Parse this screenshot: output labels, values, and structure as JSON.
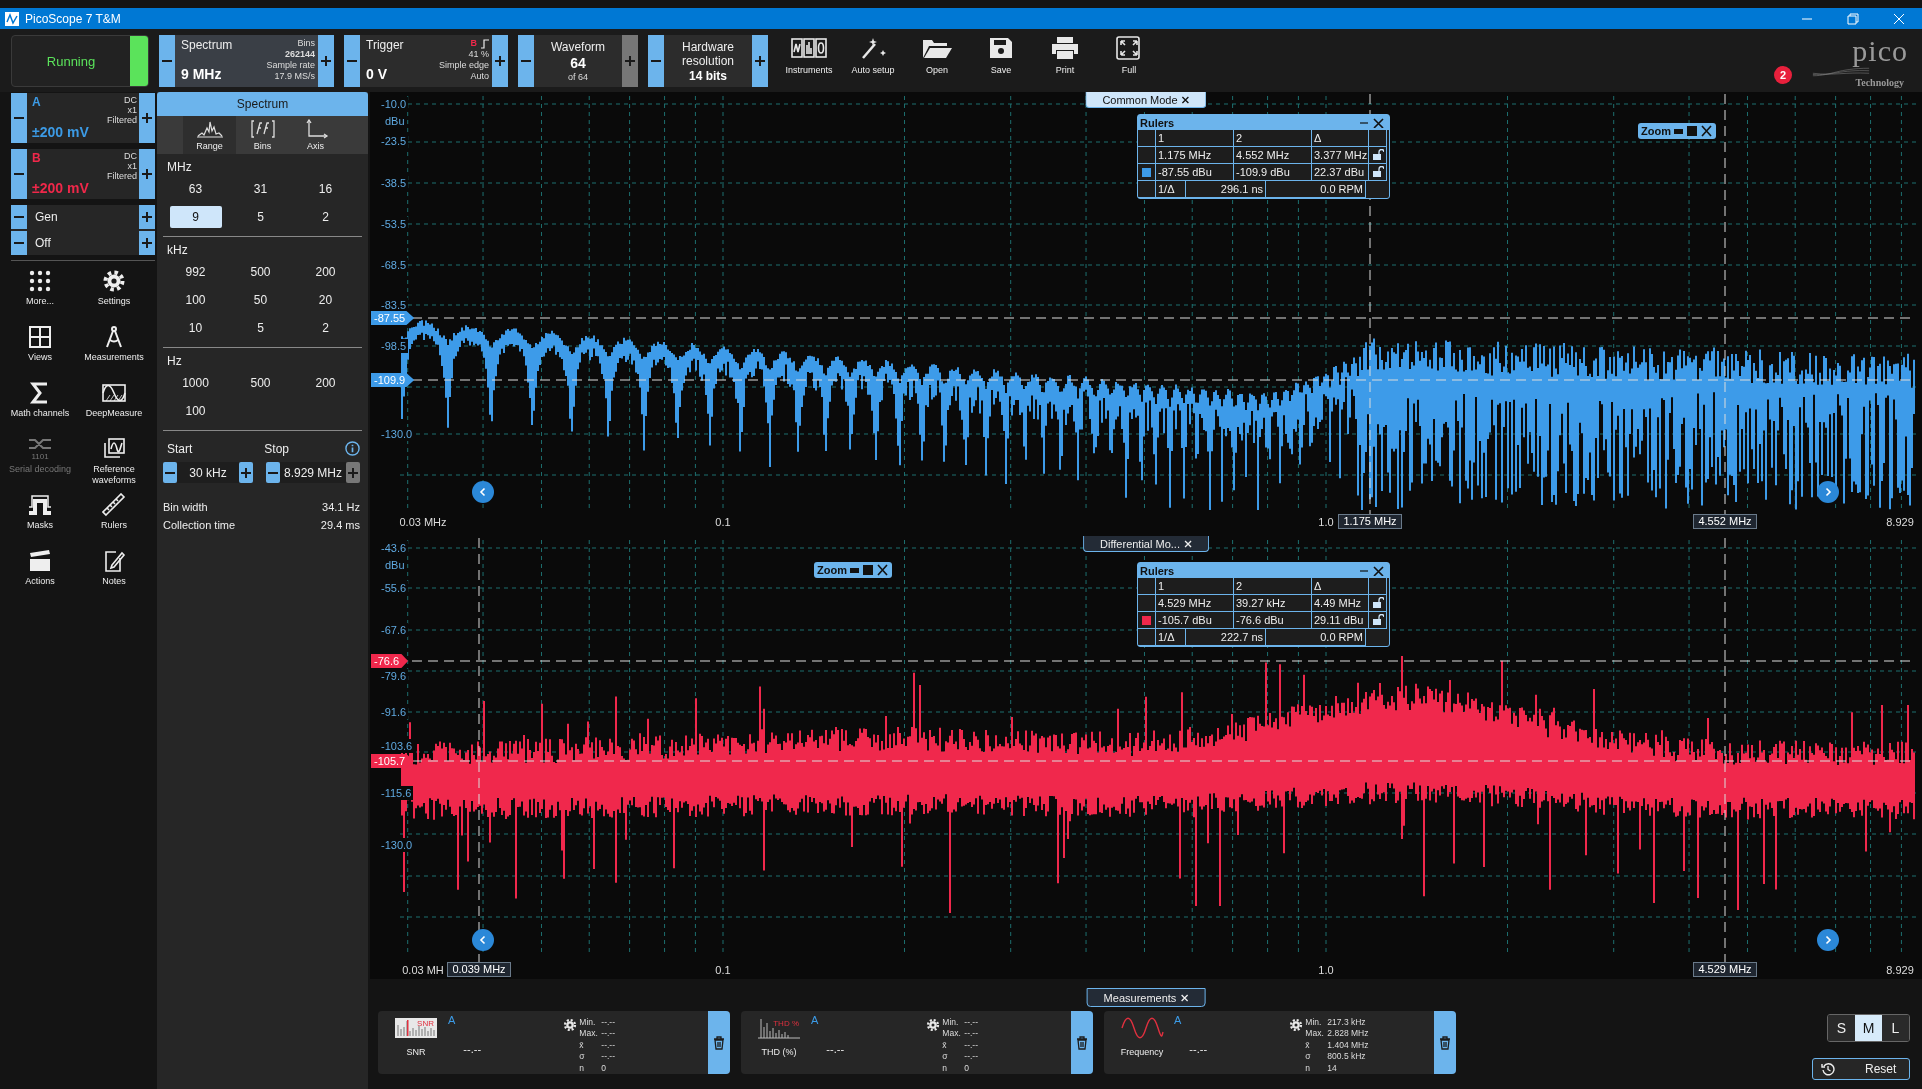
{
  "window": {
    "title": "PicoScope 7 T&M"
  },
  "run_button": {
    "label": "Running",
    "on": true
  },
  "spectrum": {
    "title": "Spectrum",
    "value": "9 MHz",
    "info": [
      "Bins",
      "262144",
      "Sample rate",
      "17.9 MS/s"
    ]
  },
  "trigger": {
    "title": "Trigger",
    "value": "0 V",
    "channel": "B",
    "info": [
      "41 %",
      "Simple edge",
      "Auto"
    ]
  },
  "waveform": {
    "title": "Waveform",
    "value": "64",
    "sub": "of 64",
    "plus_disabled": true
  },
  "resolution": {
    "title": "Hardware resolution",
    "value": "14 bits"
  },
  "toolbar_tools": [
    {
      "kind": "instruments",
      "label": "Instruments"
    },
    {
      "kind": "auto_setup",
      "label": "Auto setup"
    },
    {
      "kind": "open",
      "label": "Open"
    },
    {
      "kind": "save",
      "label": "Save"
    },
    {
      "kind": "print",
      "label": "Print"
    },
    {
      "kind": "full",
      "label": "Full"
    }
  ],
  "logo": {
    "name": "pico",
    "tagline": "Technology"
  },
  "notification_badge": "2",
  "channels": [
    {
      "name": "A",
      "range": "±200 mV",
      "coupling": "DC",
      "probe": "x1",
      "filter": "Filtered",
      "color": "#3c9be6"
    },
    {
      "name": "B",
      "range": "±200 mV",
      "coupling": "DC",
      "probe": "x1",
      "filter": "Filtered",
      "color": "#f0284a"
    }
  ],
  "generator": [
    "Gen",
    "Off"
  ],
  "tools": [
    {
      "kind": "more",
      "label": "More...",
      "disabled": false
    },
    {
      "kind": "settings",
      "label": "Settings",
      "disabled": false
    },
    {
      "kind": "views",
      "label": "Views",
      "disabled": false
    },
    {
      "kind": "measurements",
      "label": "Measurements",
      "disabled": false
    },
    {
      "kind": "math",
      "label": "Math channels",
      "disabled": false
    },
    {
      "kind": "deepmeasure",
      "label": "DeepMeasure",
      "disabled": false
    },
    {
      "kind": "serial",
      "label": "Serial decoding",
      "icon_text": "1101",
      "disabled": true
    },
    {
      "kind": "reference",
      "label": "Reference waveforms",
      "disabled": false
    },
    {
      "kind": "masks",
      "label": "Masks",
      "disabled": false
    },
    {
      "kind": "rulers",
      "label": "Rulers",
      "disabled": false
    },
    {
      "kind": "actions",
      "label": "Actions",
      "disabled": false
    },
    {
      "kind": "notes",
      "label": "Notes",
      "disabled": false
    }
  ],
  "spectrum_panel": {
    "title": "Spectrum",
    "tabs": [
      {
        "kind": "range",
        "label": "Range",
        "selected": true
      },
      {
        "kind": "bins",
        "label": "Bins",
        "selected": false
      },
      {
        "kind": "axis",
        "label": "Axis",
        "selected": false
      }
    ],
    "groups": [
      {
        "unit": "MHz",
        "options": [
          {
            "label": "63",
            "selected": false
          },
          {
            "label": "31",
            "selected": false
          },
          {
            "label": "16",
            "selected": false
          },
          {
            "label": "9",
            "selected": true
          },
          {
            "label": "5",
            "selected": false
          },
          {
            "label": "2",
            "selected": false
          }
        ]
      },
      {
        "unit": "kHz",
        "options": [
          {
            "label": "992",
            "selected": false
          },
          {
            "label": "500",
            "selected": false
          },
          {
            "label": "200",
            "selected": false
          },
          {
            "label": "100",
            "selected": false
          },
          {
            "label": "50",
            "selected": false
          },
          {
            "label": "20",
            "selected": false
          },
          {
            "label": "10",
            "selected": false
          },
          {
            "label": "5",
            "selected": false
          },
          {
            "label": "2",
            "selected": false
          }
        ]
      },
      {
        "unit": "Hz",
        "options": [
          {
            "label": "1000",
            "selected": false
          },
          {
            "label": "500",
            "selected": false
          },
          {
            "label": "200",
            "selected": false
          },
          {
            "label": "100",
            "selected": false
          }
        ]
      }
    ],
    "start": {
      "label": "Start",
      "value": "30 kHz"
    },
    "stop": {
      "label": "Stop",
      "value": "8.929 MHz"
    },
    "stats": [
      {
        "label": "Bin width",
        "value": "34.1 Hz"
      },
      {
        "label": "Collection time",
        "value": "29.4 ms"
      }
    ]
  },
  "plots": [
    {
      "tab": "Common Mode",
      "selected": true,
      "unit": "dBu",
      "color": "#3d9be9",
      "y_labels": [
        "-10.0",
        "-23.5",
        "-38.5",
        "-53.5",
        "-68.5",
        "-83.5",
        "-98.5",
        "-130.0"
      ],
      "y_markers": [
        "-87.55",
        "-109.9"
      ],
      "x_labels": [
        "0.03 MHz",
        "0.1",
        "1.0",
        "8.929"
      ],
      "x_markers": [
        "1.175 MHz",
        "4.552 MHz"
      ],
      "zoom": "Zoom",
      "rulers": {
        "title": "Rulers",
        "headers": [
          "1",
          "2",
          "Δ"
        ],
        "rows": [
          [
            "1.175 MHz",
            "4.552 MHz",
            "3.377 MHz"
          ],
          [
            "-87.55 dBu",
            "-109.9 dBu",
            "22.37 dBu"
          ]
        ],
        "inverse": [
          "1/Δ",
          "296.1 ns",
          "0.0 RPM"
        ]
      }
    },
    {
      "tab": "Differential Mo...",
      "selected": false,
      "unit": "dBu",
      "color": "#f0284c",
      "y_labels": [
        "-43.6",
        "-55.6",
        "-67.6",
        "-79.6",
        "-91.6",
        "-103.6",
        "-115.6",
        "-130.0"
      ],
      "y_markers": [
        "-76.6",
        "-105.7"
      ],
      "x_labels": [
        "0.03 MH",
        "0.1",
        "1.0",
        "8.929"
      ],
      "x_markers": [
        "0.039 MHz",
        "4.529 MHz"
      ],
      "zoom": "Zoom",
      "rulers": {
        "title": "Rulers",
        "headers": [
          "1",
          "2",
          "Δ"
        ],
        "rows": [
          [
            "4.529 MHz",
            "39.27 kHz",
            "4.49 MHz"
          ],
          [
            "-105.7 dBu",
            "-76.6 dBu",
            "29.11 dBu"
          ]
        ],
        "inverse": [
          "1/Δ",
          "222.7 ns",
          "0.0 RPM"
        ]
      }
    }
  ],
  "measurements": {
    "tab": "Measurements",
    "cards": [
      {
        "kind": "snr",
        "icon_text": "SNR",
        "name": "SNR",
        "channel": "A",
        "value": "--.--",
        "stats": [
          [
            "Min.",
            "--.--"
          ],
          [
            "Max.",
            "--.--"
          ],
          [
            "x̄",
            "--.--"
          ],
          [
            "σ",
            "--.--"
          ],
          [
            "n",
            "0"
          ]
        ]
      },
      {
        "kind": "thd",
        "icon_text": "THD %",
        "name": "THD (%)",
        "channel": "A",
        "value": "--.--",
        "stats": [
          [
            "Min.",
            "--.--"
          ],
          [
            "Max.",
            "--.--"
          ],
          [
            "x̄",
            "--.--"
          ],
          [
            "σ",
            "--.--"
          ],
          [
            "n",
            "0"
          ]
        ]
      },
      {
        "kind": "frequency",
        "name": "Frequency",
        "channel": "A",
        "value": "--.--",
        "stats": [
          [
            "Min.",
            "217.3 kHz"
          ],
          [
            "Max.",
            "2.828 MHz"
          ],
          [
            "x̄",
            "1.404 MHz"
          ],
          [
            "σ",
            "800.5 kHz"
          ],
          [
            "n",
            "14"
          ]
        ]
      }
    ]
  },
  "size_buttons": [
    {
      "label": "S",
      "selected": false
    },
    {
      "label": "M",
      "selected": true
    },
    {
      "label": "L",
      "selected": false
    }
  ],
  "reset": "Reset"
}
